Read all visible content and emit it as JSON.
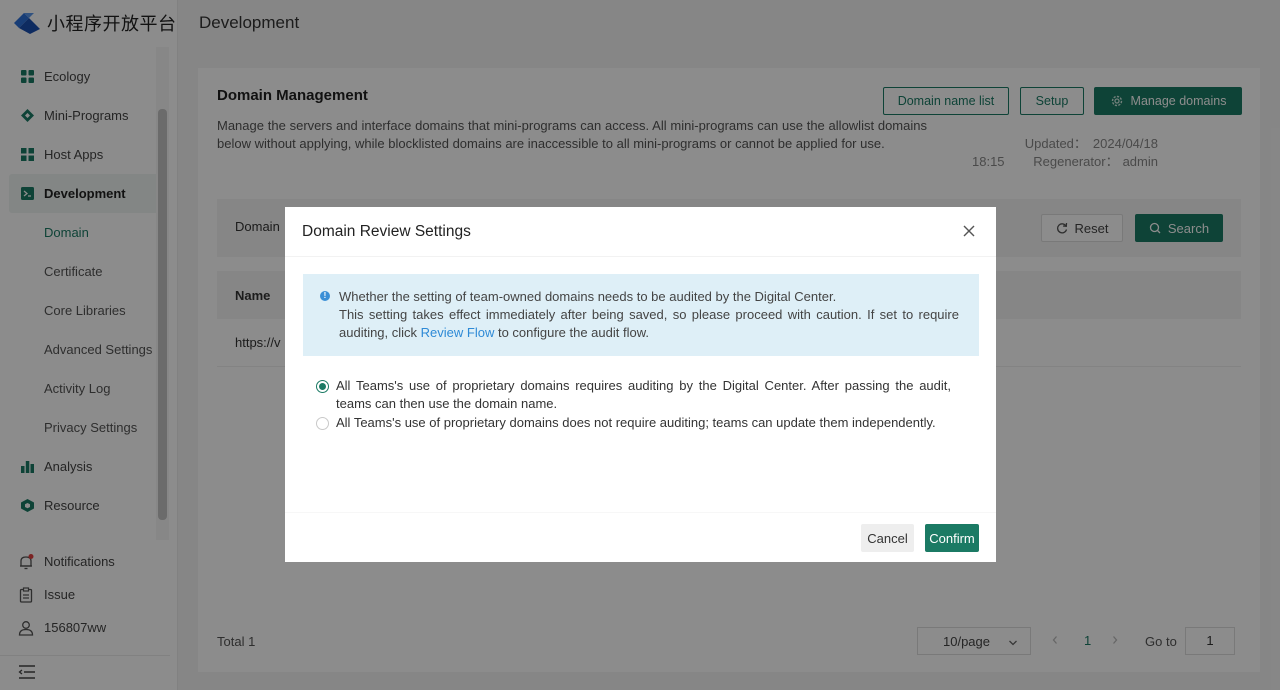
{
  "app": {
    "logo_text": "小程序开放平台"
  },
  "sidebar": {
    "items": [
      {
        "label": "Ecology",
        "icon": "grid-icon"
      },
      {
        "label": "Mini-Programs",
        "icon": "diamond-icon"
      },
      {
        "label": "Host Apps",
        "icon": "apps-icon"
      },
      {
        "label": "Development",
        "icon": "terminal-icon"
      }
    ],
    "sub_items": [
      {
        "label": "Domain"
      },
      {
        "label": "Certificate"
      },
      {
        "label": "Core Libraries"
      },
      {
        "label": "Advanced Settings"
      },
      {
        "label": "Activity Log"
      },
      {
        "label": "Privacy Settings"
      }
    ],
    "items_after": [
      {
        "label": "Analysis",
        "icon": "bar-chart-icon"
      },
      {
        "label": "Resource",
        "icon": "cube-icon"
      }
    ],
    "bottom": {
      "notifications": "Notifications",
      "issue": "Issue",
      "user": "156807ww"
    }
  },
  "header": {
    "title": "Development"
  },
  "card": {
    "title": "Domain Management",
    "description": "Manage the servers and interface domains that mini-programs can access. All mini-programs can use the allowlist domains below without applying, while blocklisted domains are inaccessible to all mini-programs or cannot be applied for use.",
    "buttons": {
      "domain_list": "Domain name list",
      "setup": "Setup",
      "manage": "Manage domains"
    },
    "updated_label": "Updated：",
    "updated_date": "2024/04/18",
    "updated_time": "18:15",
    "regenerator_label": "Regenerator：",
    "regenerator": "admin",
    "filter": {
      "label": "Domain",
      "reset": "Reset",
      "search": "Search"
    },
    "table": {
      "columns": [
        "Name"
      ],
      "rows": [
        [
          "https://v"
        ]
      ]
    },
    "pagination": {
      "total": "Total 1",
      "page_size": "10/page",
      "current_page": "1",
      "goto_label": "Go to",
      "goto_value": "1"
    }
  },
  "modal": {
    "title": "Domain Review Settings",
    "info_line1": "Whether the setting of team-owned domains needs to be audited by the Digital Center.",
    "info_line2_pre": "This setting takes effect immediately after being saved, so please proceed with caution. If set to require auditing, click ",
    "info_link": "Review Flow",
    "info_line2_post": " to configure the audit flow.",
    "options": [
      {
        "label": "All Teams's use of proprietary domains requires auditing by the Digital Center. After passing the audit, teams can then use the domain name.",
        "checked": true
      },
      {
        "label": "All Teams's use of proprietary domains does not require auditing; teams can update them independently.",
        "checked": false
      }
    ],
    "cancel": "Cancel",
    "confirm": "Confirm"
  },
  "colors": {
    "accent": "#1b7a64",
    "link": "#2e8ad6",
    "info_bg": "#deeff7"
  }
}
